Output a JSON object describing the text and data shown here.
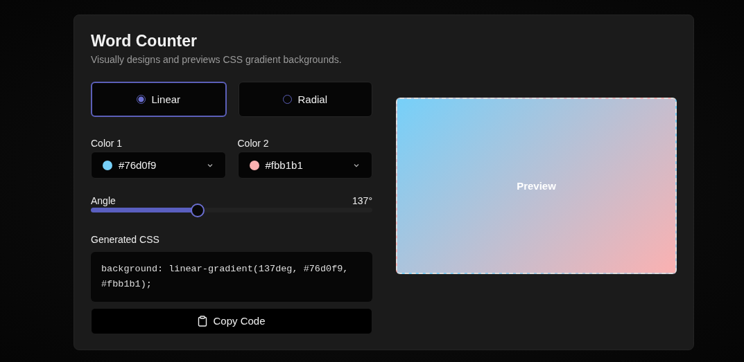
{
  "title": "Word Counter",
  "subtitle": "Visually designs and previews CSS gradient backgrounds.",
  "modes": [
    {
      "label": "Linear",
      "selected": true
    },
    {
      "label": "Radial",
      "selected": false
    }
  ],
  "colors": [
    {
      "label": "Color 1",
      "value": "#76d0f9",
      "color": "#76d0f9"
    },
    {
      "label": "Color 2",
      "value": "#fbb1b1",
      "color": "#fbb1b1"
    }
  ],
  "angle": {
    "label": "Angle",
    "reading": "137°",
    "level": 0.38
  },
  "generated": {
    "label": "Generated CSS",
    "code": "background: linear-gradient(137deg, #76d0f9, #fbb1b1);"
  },
  "copy_button": "Copy Code",
  "preview": {
    "label": "Preview"
  }
}
